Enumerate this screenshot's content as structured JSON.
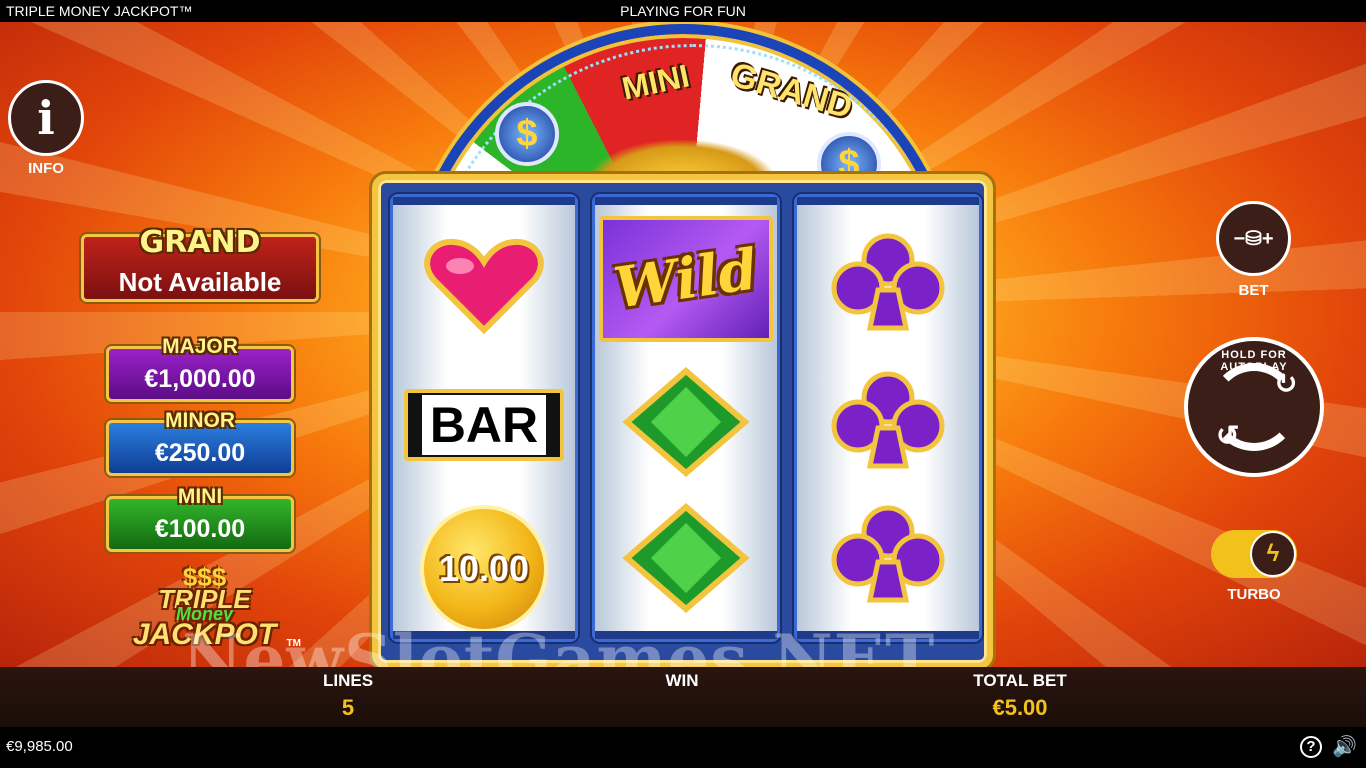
{
  "topbar": {
    "title": "TRIPLE MONEY JACKPOT™",
    "mode": "PLAYING FOR FUN"
  },
  "info": {
    "label": "INFO",
    "icon": "info-icon",
    "glyph": "i"
  },
  "jackpots": {
    "grand": {
      "name": "GRAND",
      "value": "Not Available"
    },
    "major": {
      "name": "MAJOR",
      "value": "€1,000.00"
    },
    "minor": {
      "name": "MINOR",
      "value": "€250.00"
    },
    "mini": {
      "name": "MINI",
      "value": "€100.00"
    }
  },
  "logo": {
    "dollars": "$$$",
    "line1": "TRIPLE",
    "line2": "Money",
    "line3": "JACKPOT",
    "tm": "TM"
  },
  "wheel": {
    "segment_mini": "MINI",
    "segment_grand": "GRAND",
    "coin_glyph": "$"
  },
  "reels": {
    "reel1": [
      "heart",
      "BAR",
      "10.00"
    ],
    "reel2": [
      "Wild",
      "diamond",
      "diamond"
    ],
    "reel3": [
      "club",
      "club",
      "club"
    ]
  },
  "controls": {
    "bet": {
      "label": "BET",
      "glyph": "−⛁+"
    },
    "spin": {
      "autoplay_text": "HOLD FOR AUTOPLAY",
      "arrow_top": "↻",
      "arrow_bottom": "↺"
    },
    "turbo": {
      "label": "TURBO",
      "glyph": "ϟ"
    }
  },
  "watermark": "NewSlotGames.NET",
  "infobar": {
    "lines_label": "LINES",
    "lines_value": "5",
    "win_label": "WIN",
    "win_value": "",
    "total_bet_label": "TOTAL BET",
    "total_bet_value": "€5.00"
  },
  "bottombar": {
    "balance": "€9,985.00",
    "help_glyph": "?",
    "sound_glyph": "🔊"
  },
  "colors": {
    "accent": "#f3c21a",
    "grand": "#c0231b",
    "major": "#9b21c9",
    "minor": "#2a7ee0",
    "mini": "#32b52b"
  }
}
